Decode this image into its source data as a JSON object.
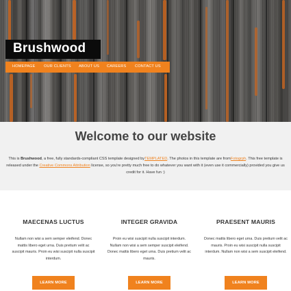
{
  "site": {
    "logo": "Brushwood",
    "nav": [
      "HOMEPAGE",
      "OUR CLIENTS",
      "ABOUT US",
      "CAREERS",
      "CONTACT US"
    ]
  },
  "welcome": {
    "heading": "Welcome to our website",
    "intro": {
      "t1": "This is ",
      "brand": "Brushwood",
      "t2": ", a free, fully standards-compliant CSS template designed by",
      "link1": "TEMPLATED",
      "t3": ". The photos in this template are from",
      "link2": "Fotogrph",
      "t4": ". This free template is released under the ",
      "link3": "Creative Commons Attribution",
      "t5": " license, so you're pretty much free to do whatever you want with it (even use it commercially) provided you give us credit for it. Have fun :)"
    }
  },
  "columns": [
    {
      "title": "MAECENAS LUCTUS",
      "text": "Nullam non wisi a sem semper eleifend. Donec mattis libero eget urna. Duis pretium velit ac suscipit mauris. Proin eu wisi suscipit nulla suscipit interdum.",
      "button": "LEARN MORE"
    },
    {
      "title": "INTEGER GRAVIDA",
      "text": "Proin eu wisi suscipit nulla suscipit interdum. Nullam non wisi a sem semper suscipit eleifend. Donec mattis libero eget urna. Duis pretium velit ac mauris.",
      "button": "LEARN MORE"
    },
    {
      "title": "PRAESENT MAURIS",
      "text": "Donec mattis libero eget urna. Duis pretium velit ac mauris. Proin eu wisi suscipit nulla suscipit interdum. Nullam non wisi a sem suscipit eleifend.",
      "button": "LEARN MORE"
    }
  ],
  "colors": {
    "accent": "#f0821e",
    "logo_bg": "#0b0b0b",
    "band_bg": "#f1f1f1"
  }
}
